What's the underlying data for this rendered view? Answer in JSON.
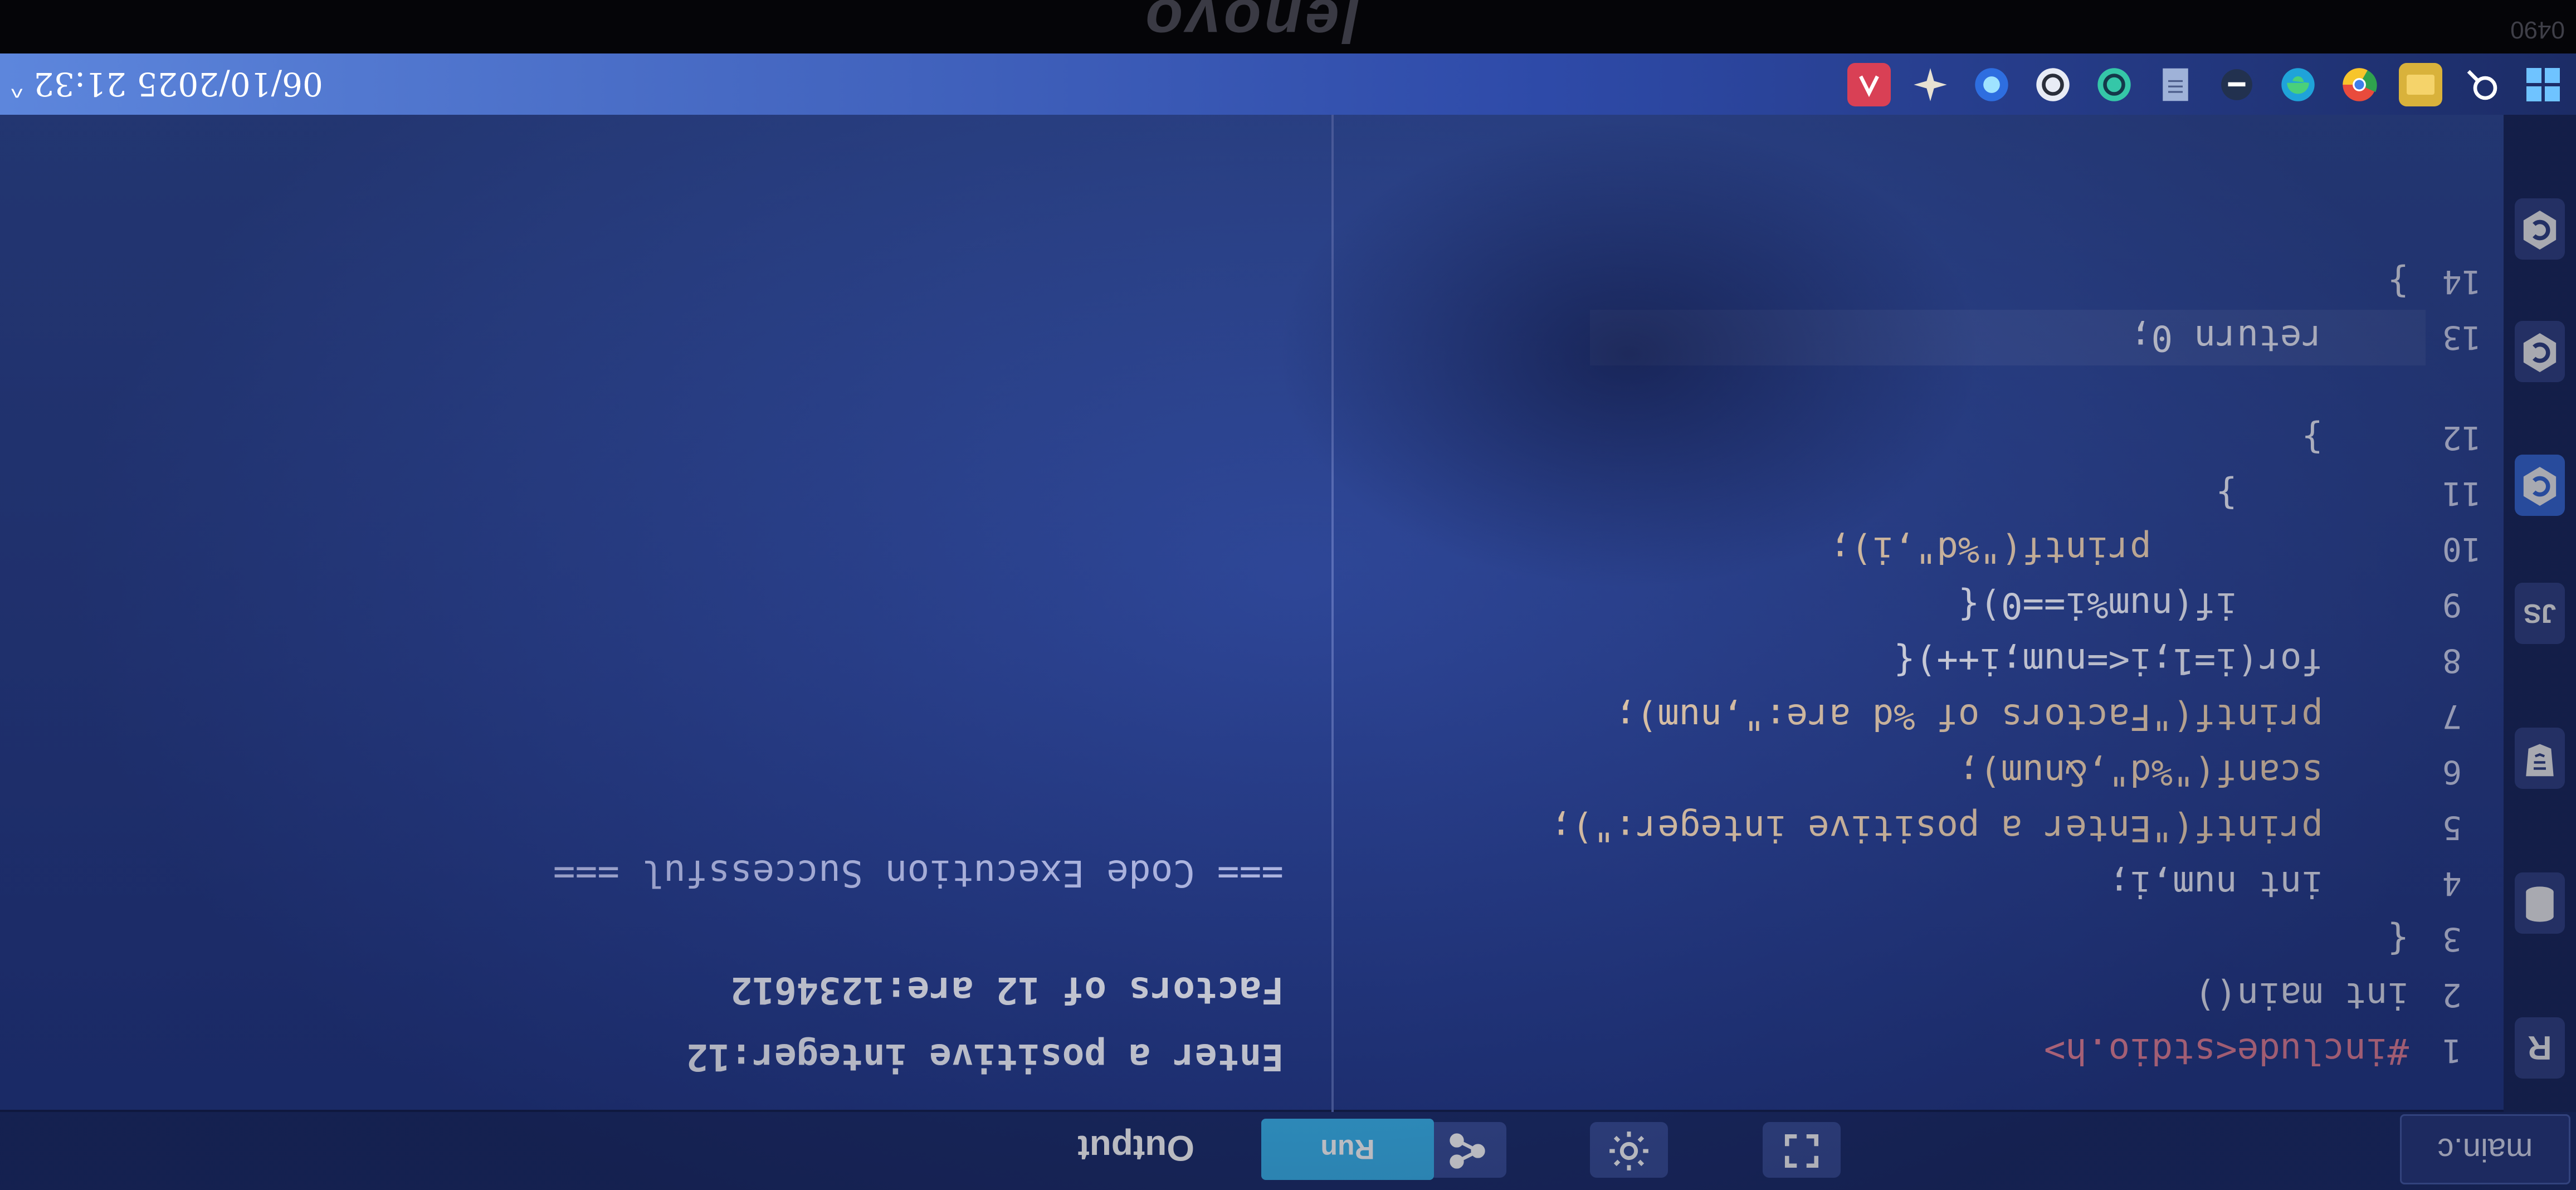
{
  "editor": {
    "file_tab": "main.c",
    "lines": [
      {
        "n": "1",
        "text": "#include<stdio.h>"
      },
      {
        "n": "2",
        "text": "int main()"
      },
      {
        "n": "3",
        "text": "{"
      },
      {
        "n": "4",
        "text": "    int num,i;"
      },
      {
        "n": "5",
        "text": "    printf(\"Enter a positive integer:\");"
      },
      {
        "n": "6",
        "text": "    scanf(\"%d\",&num);"
      },
      {
        "n": "7",
        "text": "    printf(\"Factors of %d are:\",num);"
      },
      {
        "n": "8",
        "text": "    for(i=1;i<=num;i++){"
      },
      {
        "n": "9",
        "text": "        if(num%i==0){"
      },
      {
        "n": "10",
        "text": "            printf(\"%d\",i);"
      },
      {
        "n": "11",
        "text": "        }"
      },
      {
        "n": "12",
        "text": "    }"
      },
      {
        "n": "13",
        "text": "    return 0;"
      },
      {
        "n": "14",
        "text": "}"
      }
    ]
  },
  "toolbar": {
    "run_label": "Run",
    "output_label": "Output"
  },
  "output": {
    "lines": [
      "Enter a positive integer:12",
      "Factors of 12 are:1234612",
      "=== Code Execution Successful ==="
    ]
  },
  "taskbar": {
    "clock": "06/10/2025 21:32"
  },
  "device": {
    "brand": "lenovo",
    "model": "0490"
  },
  "colors": {
    "background": "#2d4596",
    "run_button": "#3bb6ee",
    "include_text": "#f38aa0"
  }
}
